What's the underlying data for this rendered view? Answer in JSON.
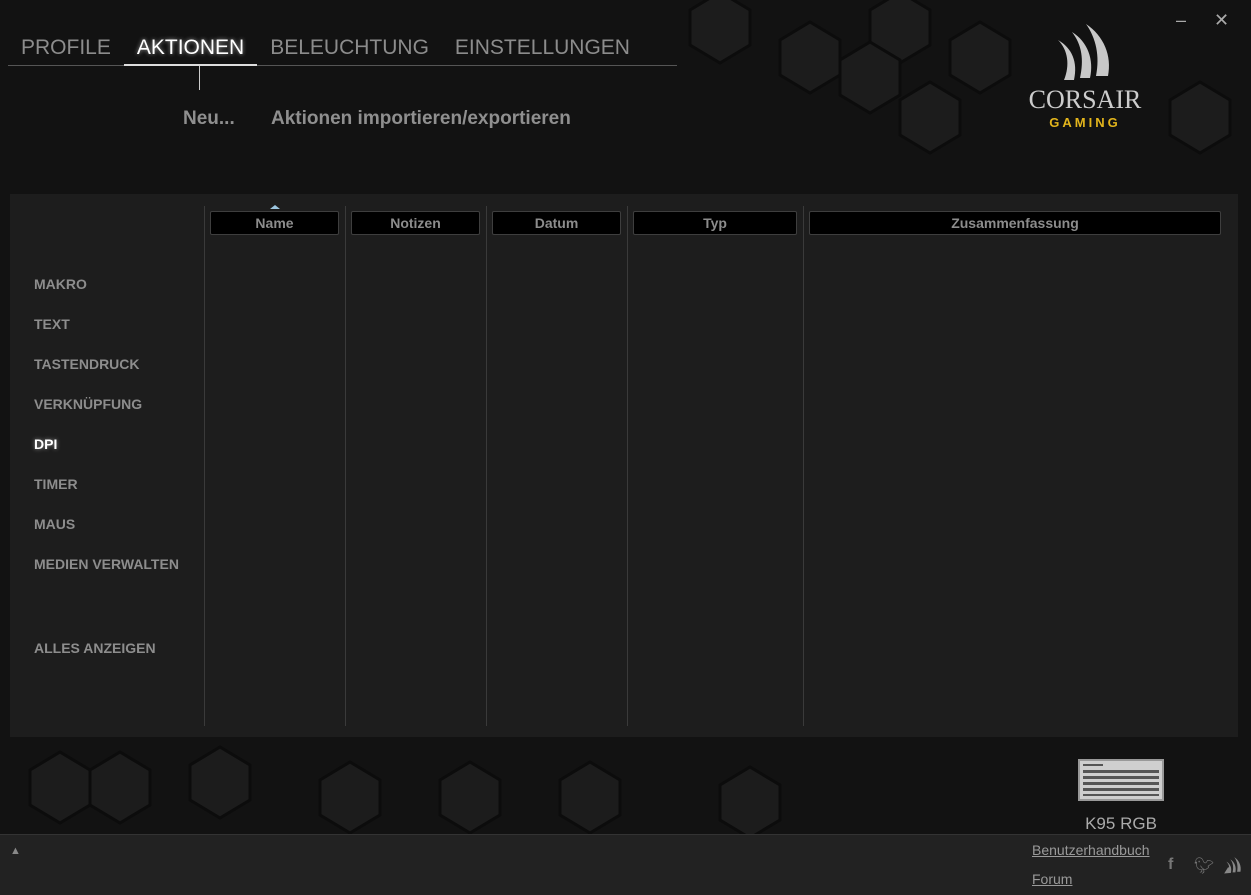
{
  "window": {
    "minimize_icon": "minimize-icon",
    "close_icon": "close-icon"
  },
  "tabs": [
    {
      "label": "PROFILE"
    },
    {
      "label": "AKTIONEN",
      "active": true
    },
    {
      "label": "BELEUCHTUNG"
    },
    {
      "label": "EINSTELLUNGEN"
    }
  ],
  "toolbar": {
    "new_label": "Neu...",
    "import_export_label": "Aktionen importieren/exportieren"
  },
  "logo": {
    "brand": "CORSAIR",
    "sub": "GAMING",
    "accent": "#e3b51c"
  },
  "sidebar": {
    "items": [
      {
        "label": "MAKRO"
      },
      {
        "label": "TEXT"
      },
      {
        "label": "TASTENDRUCK"
      },
      {
        "label": "VERKNÜPFUNG"
      },
      {
        "label": "DPI",
        "selected": true
      },
      {
        "label": "TIMER"
      },
      {
        "label": "MAUS"
      },
      {
        "label": "MEDIEN VERWALTEN"
      }
    ],
    "show_all": "ALLES ANZEIGEN"
  },
  "table": {
    "columns": [
      {
        "label": "Name",
        "sorted": "ascending"
      },
      {
        "label": "Notizen"
      },
      {
        "label": "Datum"
      },
      {
        "label": "Typ"
      },
      {
        "label": "Zusammenfassung"
      }
    ],
    "rows": []
  },
  "device": {
    "name": "K95 RGB",
    "icon": "keyboard-icon"
  },
  "footer": {
    "manual": "Benutzerhandbuch",
    "forum": "Forum",
    "social": [
      "facebook-icon",
      "twitter-icon",
      "corsair-icon"
    ]
  }
}
